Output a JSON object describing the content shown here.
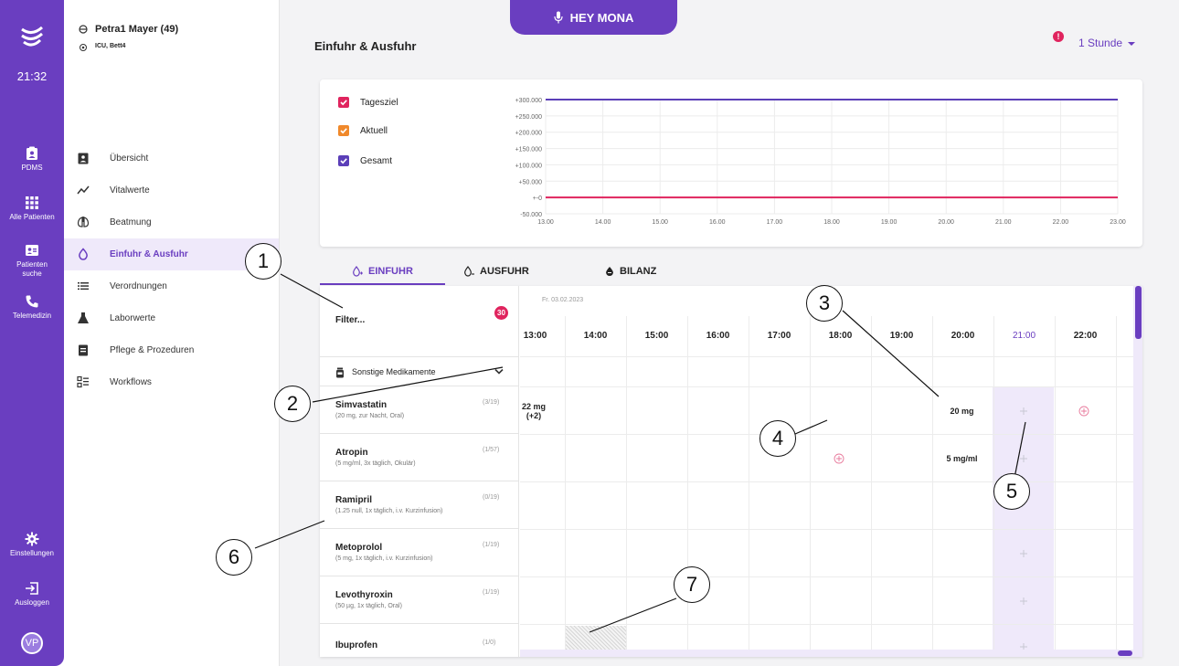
{
  "rail": {
    "clock": "21:32",
    "items": [
      {
        "label": "PDMS",
        "icon": "clipboard-icon"
      },
      {
        "label": "Alle Patienten",
        "icon": "grid-icon"
      },
      {
        "label": "Patienten suche",
        "icon": "id-card-icon"
      },
      {
        "label": "Telemedizin",
        "icon": "phone-icon"
      },
      {
        "label": "Einstellungen",
        "icon": "gear-icon"
      },
      {
        "label": "Ausloggen",
        "icon": "logout-icon"
      }
    ],
    "avatar": "VP"
  },
  "patient": {
    "name": "Petra1 Mayer (49)",
    "location": "ICU, Bett4"
  },
  "nav": {
    "items": [
      {
        "label": "Übersicht",
        "icon": "clipboard-person-icon"
      },
      {
        "label": "Vitalwerte",
        "icon": "trend-line-icon"
      },
      {
        "label": "Beatmung",
        "icon": "lungs-icon"
      },
      {
        "label": "Einfuhr & Ausfuhr",
        "icon": "droplet-icon"
      },
      {
        "label": "Verordnungen",
        "icon": "list-icon"
      },
      {
        "label": "Laborwerte",
        "icon": "flask-icon"
      },
      {
        "label": "Pflege & Prozeduren",
        "icon": "clipboard-check-icon"
      },
      {
        "label": "Workflows",
        "icon": "workflow-list-icon"
      }
    ],
    "active_index": 3
  },
  "header": {
    "voice_button": "HEY MONA",
    "title": "Einfuhr & Ausfuhr",
    "alert": "!",
    "interval": "1 Stunde"
  },
  "chart_data": {
    "type": "line",
    "legend": [
      {
        "label": "Tagesziel",
        "color": "#e0245e",
        "checked": true
      },
      {
        "label": "Aktuell",
        "color": "#f0892b",
        "checked": true
      },
      {
        "label": "Gesamt",
        "color": "#5b3fb8",
        "checked": true
      }
    ],
    "y_ticks": [
      "+300.000",
      "+250.000",
      "+200.000",
      "+150.000",
      "+100.000",
      "+50.000",
      "+-0",
      "-50.000"
    ],
    "x_ticks": [
      "13.00",
      "14.00",
      "15.00",
      "16.00",
      "17.00",
      "18.00",
      "19.00",
      "20.00",
      "21.00",
      "22.00",
      "23.00"
    ],
    "ylim": [
      -50000,
      300000
    ],
    "series": [
      {
        "name": "Gesamt",
        "color": "#5b3fb8",
        "values": [
          300000,
          300000,
          300000,
          300000,
          300000,
          300000,
          300000,
          300000,
          300000,
          300000,
          300000
        ]
      },
      {
        "name": "Tagesziel",
        "color": "#e0245e",
        "values": [
          0,
          0,
          0,
          0,
          0,
          0,
          0,
          0,
          0,
          0,
          0
        ]
      }
    ]
  },
  "tabs": [
    {
      "label": "EINFUHR",
      "icon": "droplet-plus-icon",
      "active": true
    },
    {
      "label": "AUSFUHR",
      "icon": "droplet-minus-icon",
      "active": false
    },
    {
      "label": "BILANZ",
      "icon": "balance-icon",
      "active": false
    }
  ],
  "table": {
    "filter_label": "Filter...",
    "filter_badge": "30",
    "date": "Fr. 03.02.2023",
    "hours": [
      "13:00",
      "14:00",
      "15:00",
      "16:00",
      "17:00",
      "18:00",
      "19:00",
      "20:00",
      "21:00",
      "22:00"
    ],
    "current_hour_index": 8,
    "group": "Sonstige Medikamente",
    "medications": [
      {
        "name": "Simvastatin",
        "desc": "(20 mg, zur Nacht, Oral)",
        "count": "(3/19)"
      },
      {
        "name": "Atropin",
        "desc": "(5 mg/ml, 3x täglich, Okulär)",
        "count": "(1/57)"
      },
      {
        "name": "Ramipril",
        "desc": "(1.25 null, 1x täglich, i.v. Kurzinfusion)",
        "count": "(0/19)"
      },
      {
        "name": "Metoprolol",
        "desc": "(5 mg, 1x täglich, i.v. Kurzinfusion)",
        "count": "(1/19)"
      },
      {
        "name": "Levothyroxin",
        "desc": "(50 µg, 1x täglich, Oral)",
        "count": "(1/19)"
      },
      {
        "name": "Ibuprofen",
        "desc": "",
        "count": "(1/0)"
      }
    ],
    "cells": {
      "simvastatin_13": "22 mg",
      "simvastatin_13_extra": "(+2)",
      "simvastatin_20": "20 mg",
      "atropin_20": "5 mg/ml"
    }
  },
  "callouts": [
    "1",
    "2",
    "3",
    "4",
    "5",
    "6",
    "7"
  ],
  "colors": {
    "primary": "#6a3ec0",
    "accent_pink": "#e0245e",
    "highlight": "#efe9fa"
  }
}
